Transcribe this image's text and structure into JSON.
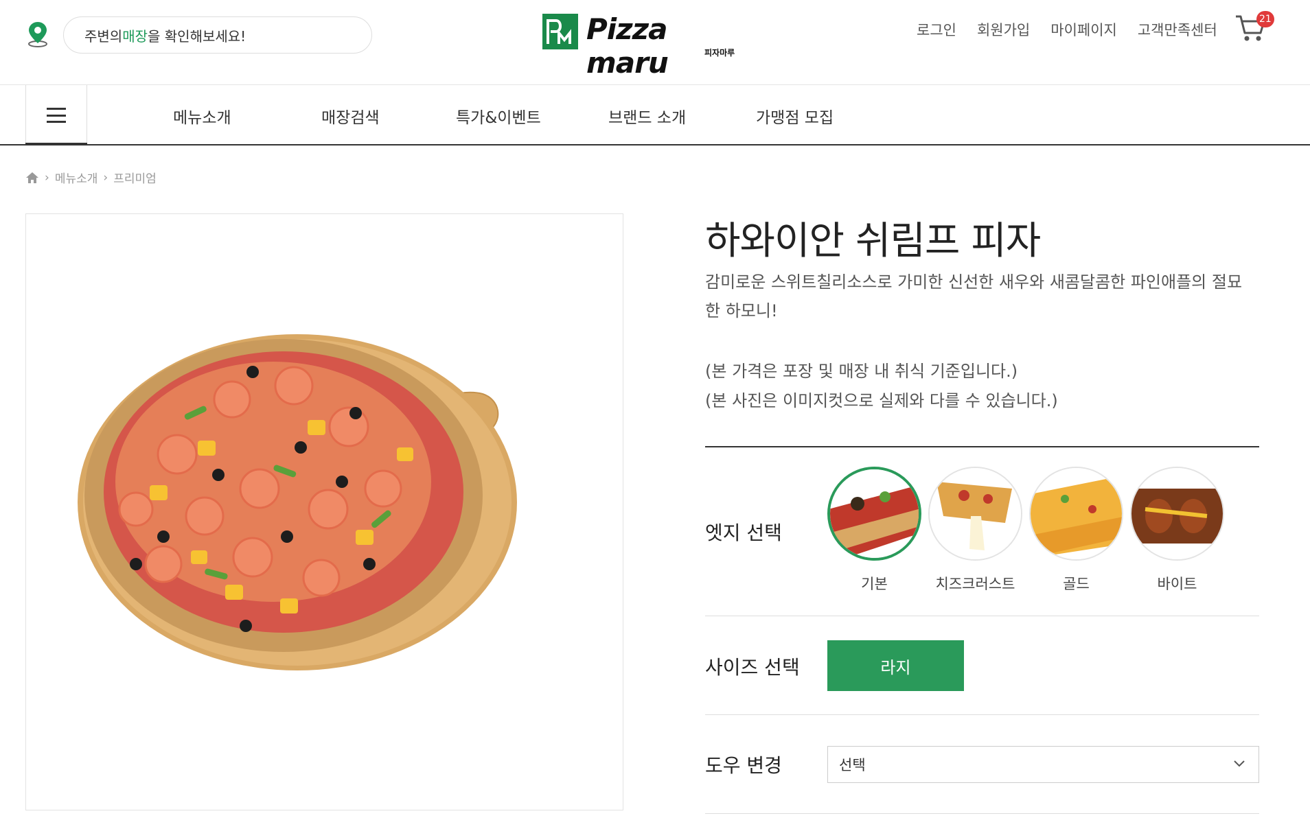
{
  "header": {
    "store_search": {
      "prefix": "주변의 ",
      "highlight": "매장",
      "suffix": "을 확인해보세요!"
    },
    "logo": {
      "text": "Pizza maru",
      "subtext": "피자마루"
    },
    "links": [
      "로그인",
      "회원가입",
      "마이페이지",
      "고객만족센터"
    ],
    "cart_count": "21"
  },
  "nav": {
    "items": [
      "메뉴소개",
      "매장검색",
      "특가&이벤트",
      "브랜드 소개",
      "가맹점 모집"
    ]
  },
  "breadcrumb": [
    "메뉴소개",
    "프리미엄"
  ],
  "product": {
    "title": "하와이안 쉬림프 피자",
    "description": "감미로운 스위트칠리소스로 가미한 신선한 새우와 새콤달콤한 파인애플의 절묘한 하모니!",
    "notes": [
      "(본 가격은 포장 및 매장 내 취식 기준입니다.)",
      "(본 사진은 이미지컷으로 실제와 다를 수 있습니다.)"
    ]
  },
  "options": {
    "edge_label": "엣지 선택",
    "edges": [
      {
        "label": "기본",
        "selected": true
      },
      {
        "label": "치즈크러스트",
        "selected": false
      },
      {
        "label": "골드",
        "selected": false
      },
      {
        "label": "바이트",
        "selected": false
      }
    ],
    "size_label": "사이즈 선택",
    "size_value": "라지",
    "dough_label": "도우 변경",
    "dough_value": "선택"
  },
  "colors": {
    "brand_green": "#2a9a5a",
    "badge_red": "#e03a3a"
  }
}
